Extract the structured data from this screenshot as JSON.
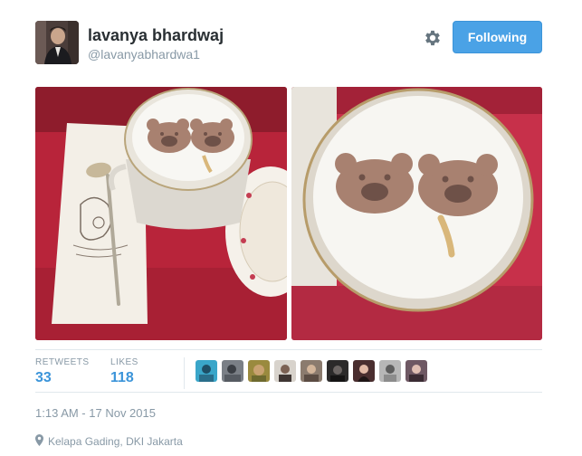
{
  "tweet": {
    "display_name": "lavanya bhardwaj",
    "handle": "@lavanyabhardwa1",
    "follow_button_label": "Following",
    "stats": {
      "retweets_label": "RETWEETS",
      "retweets_count": "33",
      "likes_label": "LIKES",
      "likes_count": "118"
    },
    "liker_avatar_count": 9,
    "timestamp": "1:13 AM - 17 Nov 2015",
    "location": "Kelapa Gading, DKI Jakarta"
  },
  "icons": {
    "settings": "gear-icon",
    "location": "map-pin-icon"
  },
  "colors": {
    "follow_button": "#4aa2e6",
    "stat_value": "#3b94d9",
    "muted_text": "#8899a6"
  }
}
